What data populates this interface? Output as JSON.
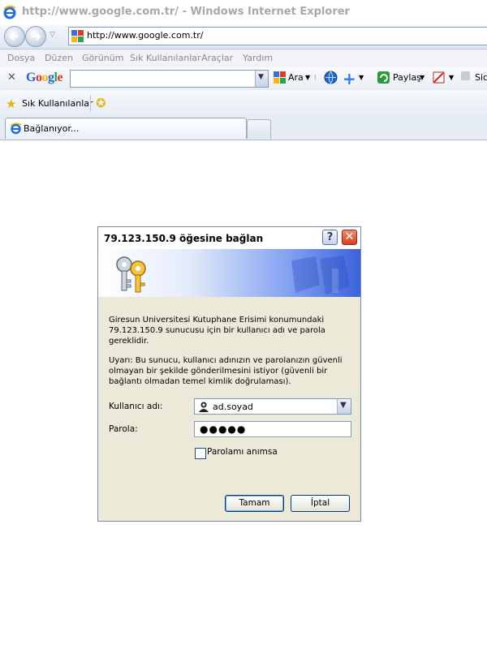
{
  "window": {
    "title": "http://www.google.com.tr/ - Windows Internet Explorer"
  },
  "navigation": {
    "address_url": "http://www.google.com.tr/"
  },
  "menubar": {
    "items": [
      "Dosya",
      "Düzen",
      "Görünüm",
      "Sık Kullanılanlar",
      "Araçlar",
      "Yardım"
    ]
  },
  "google_toolbar": {
    "logo": "Google",
    "search_value": "",
    "search_button": "Ara",
    "share_button": "Paylaş",
    "cut_label": "Sic"
  },
  "favorites_bar": {
    "favorites_label": "Sık Kullanılanlar"
  },
  "tabs": {
    "active_tab": "Bağlanıyor..."
  },
  "dialog": {
    "title": "79.123.150.9 öğesine bağlan",
    "help_glyph": "?",
    "close_glyph": "✕",
    "message": "Giresun Universitesi Kutuphane Erisimi konumundaki 79.123.150.9 sunucusu için bir kullanıcı adı ve parola gereklidir.",
    "warning": "Uyarı: Bu sunucu, kullanıcı adınızın ve parolanızın güvenli olmayan bir şekilde gönderilmesini istiyor (güvenli bir bağlantı olmadan temel kimlik doğrulaması).",
    "username_label": "Kullanıcı adı:",
    "username_value": "ad.soyad",
    "password_label": "Parola:",
    "password_value": "●●●●●",
    "remember_label": "Parolamı anımsa",
    "remember_checked": false,
    "ok_label": "Tamam",
    "cancel_label": "İptal"
  },
  "icons": {
    "browser": "ie-logo-icon",
    "back": "back-arrow-icon",
    "forward": "forward-arrow-icon",
    "favorites": "star-icon",
    "add_favorites": "add-favorites-star-icon",
    "keys": "keys-icon",
    "user": "user-icon"
  },
  "colors": {
    "dialog_bg": "#ece9d8",
    "banner_blue": "#3c63d9",
    "close_red": "#d2421f",
    "title_gray": "#a8a8a8"
  }
}
